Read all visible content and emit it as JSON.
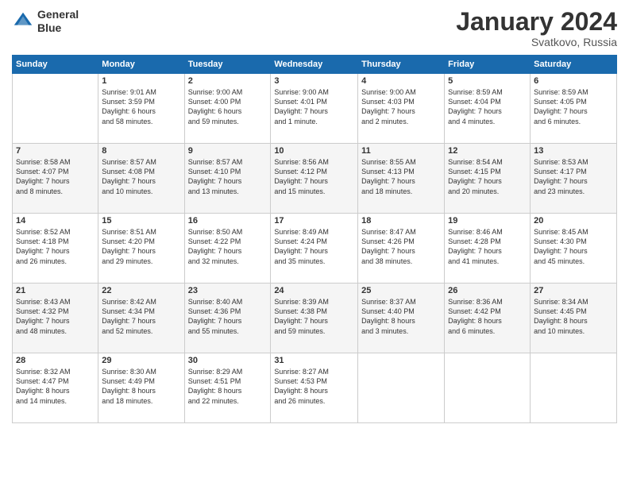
{
  "logo": {
    "line1": "General",
    "line2": "Blue"
  },
  "title": "January 2024",
  "location": "Svatkovo, Russia",
  "days_header": [
    "Sunday",
    "Monday",
    "Tuesday",
    "Wednesday",
    "Thursday",
    "Friday",
    "Saturday"
  ],
  "weeks": [
    [
      {
        "num": "",
        "info": ""
      },
      {
        "num": "1",
        "info": "Sunrise: 9:01 AM\nSunset: 3:59 PM\nDaylight: 6 hours\nand 58 minutes."
      },
      {
        "num": "2",
        "info": "Sunrise: 9:00 AM\nSunset: 4:00 PM\nDaylight: 6 hours\nand 59 minutes."
      },
      {
        "num": "3",
        "info": "Sunrise: 9:00 AM\nSunset: 4:01 PM\nDaylight: 7 hours\nand 1 minute."
      },
      {
        "num": "4",
        "info": "Sunrise: 9:00 AM\nSunset: 4:03 PM\nDaylight: 7 hours\nand 2 minutes."
      },
      {
        "num": "5",
        "info": "Sunrise: 8:59 AM\nSunset: 4:04 PM\nDaylight: 7 hours\nand 4 minutes."
      },
      {
        "num": "6",
        "info": "Sunrise: 8:59 AM\nSunset: 4:05 PM\nDaylight: 7 hours\nand 6 minutes."
      }
    ],
    [
      {
        "num": "7",
        "info": "Sunrise: 8:58 AM\nSunset: 4:07 PM\nDaylight: 7 hours\nand 8 minutes."
      },
      {
        "num": "8",
        "info": "Sunrise: 8:57 AM\nSunset: 4:08 PM\nDaylight: 7 hours\nand 10 minutes."
      },
      {
        "num": "9",
        "info": "Sunrise: 8:57 AM\nSunset: 4:10 PM\nDaylight: 7 hours\nand 13 minutes."
      },
      {
        "num": "10",
        "info": "Sunrise: 8:56 AM\nSunset: 4:12 PM\nDaylight: 7 hours\nand 15 minutes."
      },
      {
        "num": "11",
        "info": "Sunrise: 8:55 AM\nSunset: 4:13 PM\nDaylight: 7 hours\nand 18 minutes."
      },
      {
        "num": "12",
        "info": "Sunrise: 8:54 AM\nSunset: 4:15 PM\nDaylight: 7 hours\nand 20 minutes."
      },
      {
        "num": "13",
        "info": "Sunrise: 8:53 AM\nSunset: 4:17 PM\nDaylight: 7 hours\nand 23 minutes."
      }
    ],
    [
      {
        "num": "14",
        "info": "Sunrise: 8:52 AM\nSunset: 4:18 PM\nDaylight: 7 hours\nand 26 minutes."
      },
      {
        "num": "15",
        "info": "Sunrise: 8:51 AM\nSunset: 4:20 PM\nDaylight: 7 hours\nand 29 minutes."
      },
      {
        "num": "16",
        "info": "Sunrise: 8:50 AM\nSunset: 4:22 PM\nDaylight: 7 hours\nand 32 minutes."
      },
      {
        "num": "17",
        "info": "Sunrise: 8:49 AM\nSunset: 4:24 PM\nDaylight: 7 hours\nand 35 minutes."
      },
      {
        "num": "18",
        "info": "Sunrise: 8:47 AM\nSunset: 4:26 PM\nDaylight: 7 hours\nand 38 minutes."
      },
      {
        "num": "19",
        "info": "Sunrise: 8:46 AM\nSunset: 4:28 PM\nDaylight: 7 hours\nand 41 minutes."
      },
      {
        "num": "20",
        "info": "Sunrise: 8:45 AM\nSunset: 4:30 PM\nDaylight: 7 hours\nand 45 minutes."
      }
    ],
    [
      {
        "num": "21",
        "info": "Sunrise: 8:43 AM\nSunset: 4:32 PM\nDaylight: 7 hours\nand 48 minutes."
      },
      {
        "num": "22",
        "info": "Sunrise: 8:42 AM\nSunset: 4:34 PM\nDaylight: 7 hours\nand 52 minutes."
      },
      {
        "num": "23",
        "info": "Sunrise: 8:40 AM\nSunset: 4:36 PM\nDaylight: 7 hours\nand 55 minutes."
      },
      {
        "num": "24",
        "info": "Sunrise: 8:39 AM\nSunset: 4:38 PM\nDaylight: 7 hours\nand 59 minutes."
      },
      {
        "num": "25",
        "info": "Sunrise: 8:37 AM\nSunset: 4:40 PM\nDaylight: 8 hours\nand 3 minutes."
      },
      {
        "num": "26",
        "info": "Sunrise: 8:36 AM\nSunset: 4:42 PM\nDaylight: 8 hours\nand 6 minutes."
      },
      {
        "num": "27",
        "info": "Sunrise: 8:34 AM\nSunset: 4:45 PM\nDaylight: 8 hours\nand 10 minutes."
      }
    ],
    [
      {
        "num": "28",
        "info": "Sunrise: 8:32 AM\nSunset: 4:47 PM\nDaylight: 8 hours\nand 14 minutes."
      },
      {
        "num": "29",
        "info": "Sunrise: 8:30 AM\nSunset: 4:49 PM\nDaylight: 8 hours\nand 18 minutes."
      },
      {
        "num": "30",
        "info": "Sunrise: 8:29 AM\nSunset: 4:51 PM\nDaylight: 8 hours\nand 22 minutes."
      },
      {
        "num": "31",
        "info": "Sunrise: 8:27 AM\nSunset: 4:53 PM\nDaylight: 8 hours\nand 26 minutes."
      },
      {
        "num": "",
        "info": ""
      },
      {
        "num": "",
        "info": ""
      },
      {
        "num": "",
        "info": ""
      }
    ]
  ]
}
